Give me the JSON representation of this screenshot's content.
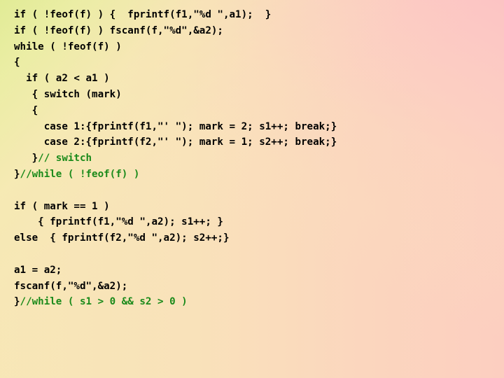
{
  "slide": {
    "kind": "code-listing",
    "language": "c",
    "colors": {
      "code_text": "#000000",
      "comment_text": "#1a8a1a",
      "bg_top_left": "#e1ec96",
      "bg_top_right": "#fad8c0",
      "bg_bottom_left": "#f8e4be",
      "bg_bottom_right": "#fac6c6",
      "bg_center": "#f7e8b8"
    },
    "code_lines": [
      {
        "text": "if ( !feof(f) ) {  fprintf(f1,\"%d \",a1);  }"
      },
      {
        "text": "if ( !feof(f) ) fscanf(f,\"%d\",&a2);"
      },
      {
        "text": "while ( !feof(f) )"
      },
      {
        "text": "{"
      },
      {
        "text": "  if ( a2 < a1 )"
      },
      {
        "text": "   { switch (mark)"
      },
      {
        "text": "   {"
      },
      {
        "text": "     case 1:{fprintf(f1,\"' \"); mark = 2; s1++; break;}"
      },
      {
        "text": "     case 2:{fprintf(f2,\"' \"); mark = 1; s2++; break;}"
      },
      {
        "text": "   }",
        "comment": "// switch"
      },
      {
        "text": "}",
        "comment": "//while ( !feof(f) )"
      },
      {
        "text": ""
      },
      {
        "text": "if ( mark == 1 )"
      },
      {
        "text": "    { fprintf(f1,\"%d \",a2); s1++; }"
      },
      {
        "text": "else  { fprintf(f2,\"%d \",a2); s2++;}"
      },
      {
        "text": ""
      },
      {
        "text": "a1 = a2;"
      },
      {
        "text": "fscanf(f,\"%d\",&a2);"
      },
      {
        "text": "}",
        "comment": "//while ( s1 > 0 && s2 > 0 )"
      }
    ]
  }
}
